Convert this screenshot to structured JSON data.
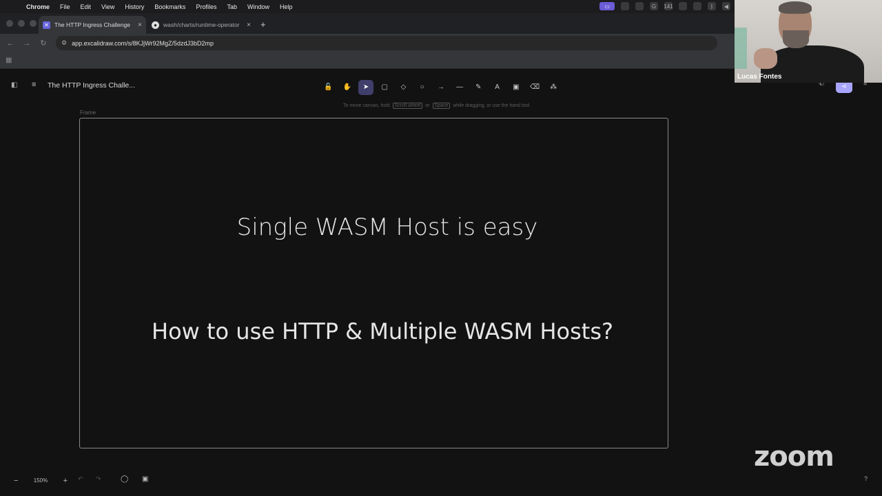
{
  "menubar": {
    "items": [
      "Chrome",
      "File",
      "Edit",
      "View",
      "History",
      "Bookmarks",
      "Profiles",
      "Tab",
      "Window",
      "Help"
    ],
    "status_badge": "141"
  },
  "tabs": [
    {
      "title": "The HTTP Ingress Challenge"
    },
    {
      "title": "wash/charts/runtime-operator"
    }
  ],
  "url": "app.excalidraw.com/s/8KJjWr92MgZ/5dzdJ3bD2mp",
  "excalidraw": {
    "doc_title": "The HTTP Ingress Challe...",
    "hint": {
      "pre": "To move canvas, hold",
      "key1": "Scroll wheel",
      "mid": "or",
      "key2": "Space",
      "post": "while dragging, or use the hand tool"
    },
    "frame_label": "Frame",
    "text_line1": "Single WASM Host is easy",
    "text_line2": "How to use HTTP & Multiple WASM Hosts?",
    "zoom_level": "150%",
    "tools": [
      {
        "name": "lock-icon",
        "glyph": "🔓"
      },
      {
        "name": "hand-icon",
        "glyph": "✋"
      },
      {
        "name": "selection-icon",
        "glyph": "➤",
        "selected": true
      },
      {
        "name": "rectangle-icon",
        "glyph": "▢"
      },
      {
        "name": "diamond-icon",
        "glyph": "◇"
      },
      {
        "name": "ellipse-icon",
        "glyph": "○"
      },
      {
        "name": "arrow-icon",
        "glyph": "→"
      },
      {
        "name": "line-icon",
        "glyph": "—"
      },
      {
        "name": "draw-icon",
        "glyph": "✎"
      },
      {
        "name": "text-icon",
        "glyph": "A"
      },
      {
        "name": "image-icon",
        "glyph": "▣"
      },
      {
        "name": "eraser-icon",
        "glyph": "⌫"
      },
      {
        "name": "library-icon",
        "glyph": "⁂"
      }
    ]
  },
  "zoom_call": {
    "participant_name": "Lucas Fontes",
    "logo_text": "zoom"
  }
}
